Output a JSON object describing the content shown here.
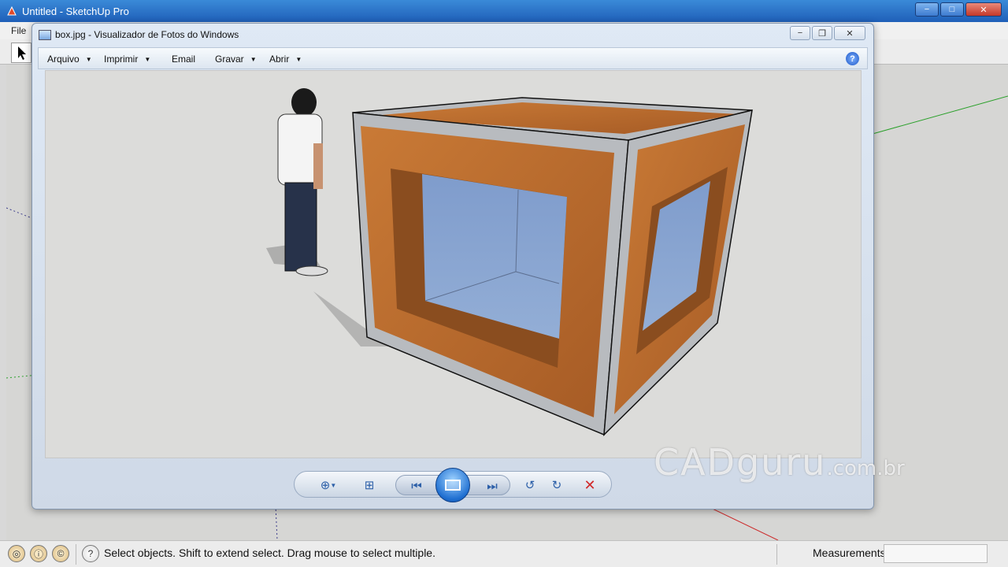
{
  "sketchup": {
    "title": "Untitled - SketchUp Pro",
    "menu_file": "File",
    "status_text": "Select objects. Shift to extend select. Drag mouse to select multiple.",
    "measurements_label": "Measurements",
    "window_buttons": {
      "minimize": "−",
      "maximize": "□",
      "close": "✕"
    }
  },
  "photo_viewer": {
    "title": "box.jpg - Visualizador de Fotos do Windows",
    "menu": [
      {
        "label": "Arquivo"
      },
      {
        "label": "Imprimir"
      },
      {
        "label": "Email"
      },
      {
        "label": "Gravar"
      },
      {
        "label": "Abrir"
      }
    ],
    "help_symbol": "?",
    "icons": [
      "zoom-icon",
      "fit-window-icon",
      "previous-icon",
      "slideshow-icon",
      "next-icon",
      "rotate-left-icon",
      "rotate-right-icon",
      "delete-icon"
    ]
  },
  "watermark": {
    "main": "CADguru",
    "suffix": ".com.br"
  },
  "colors": {
    "accent": "#1f6fd1",
    "wood": "#b86a2e",
    "frame": "#b9bcc0",
    "glass": "#7f9ccc",
    "delete": "#d12a2a"
  }
}
